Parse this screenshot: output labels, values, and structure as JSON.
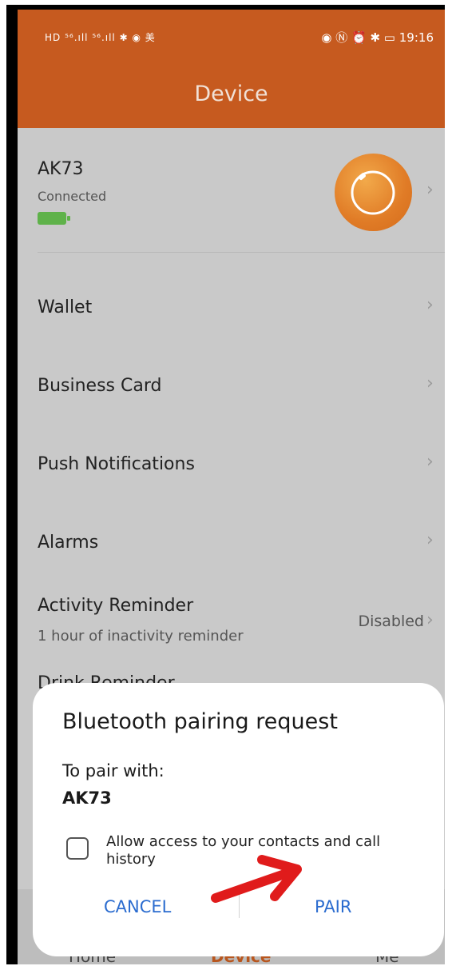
{
  "status_bar": {
    "left_icons": "HD ⁵⁶.ıll ⁵⁶.ıll ✱ ◉ 美",
    "right_icons": "◉ Ⓝ ⏰ ✱ ▭",
    "time": "19:16"
  },
  "header": {
    "title": "Device"
  },
  "device": {
    "name": "AK73",
    "status": "Connected"
  },
  "menu": {
    "wallet": "Wallet",
    "business_card": "Business Card",
    "push_notifications": "Push Notifications",
    "alarms": "Alarms",
    "activity_reminder": "Activity Reminder",
    "activity_reminder_sub": "1 hour of inactivity reminder",
    "activity_reminder_value": "Disabled",
    "drink_reminder_partial": "Drink Reminder"
  },
  "bottom_nav": {
    "home": "Home",
    "device": "Device",
    "me": "Me"
  },
  "dialog": {
    "title": "Bluetooth pairing request",
    "to_pair_with": "To pair with:",
    "device_name": "AK73",
    "checkbox_label": "Allow access to your contacts and call history",
    "cancel": "CANCEL",
    "pair": "PAIR"
  },
  "colors": {
    "header": "#c65a1f",
    "accent_blue": "#2b6ccf",
    "arrow_red": "#e01b1b",
    "battery_green": "#5fb24a"
  }
}
